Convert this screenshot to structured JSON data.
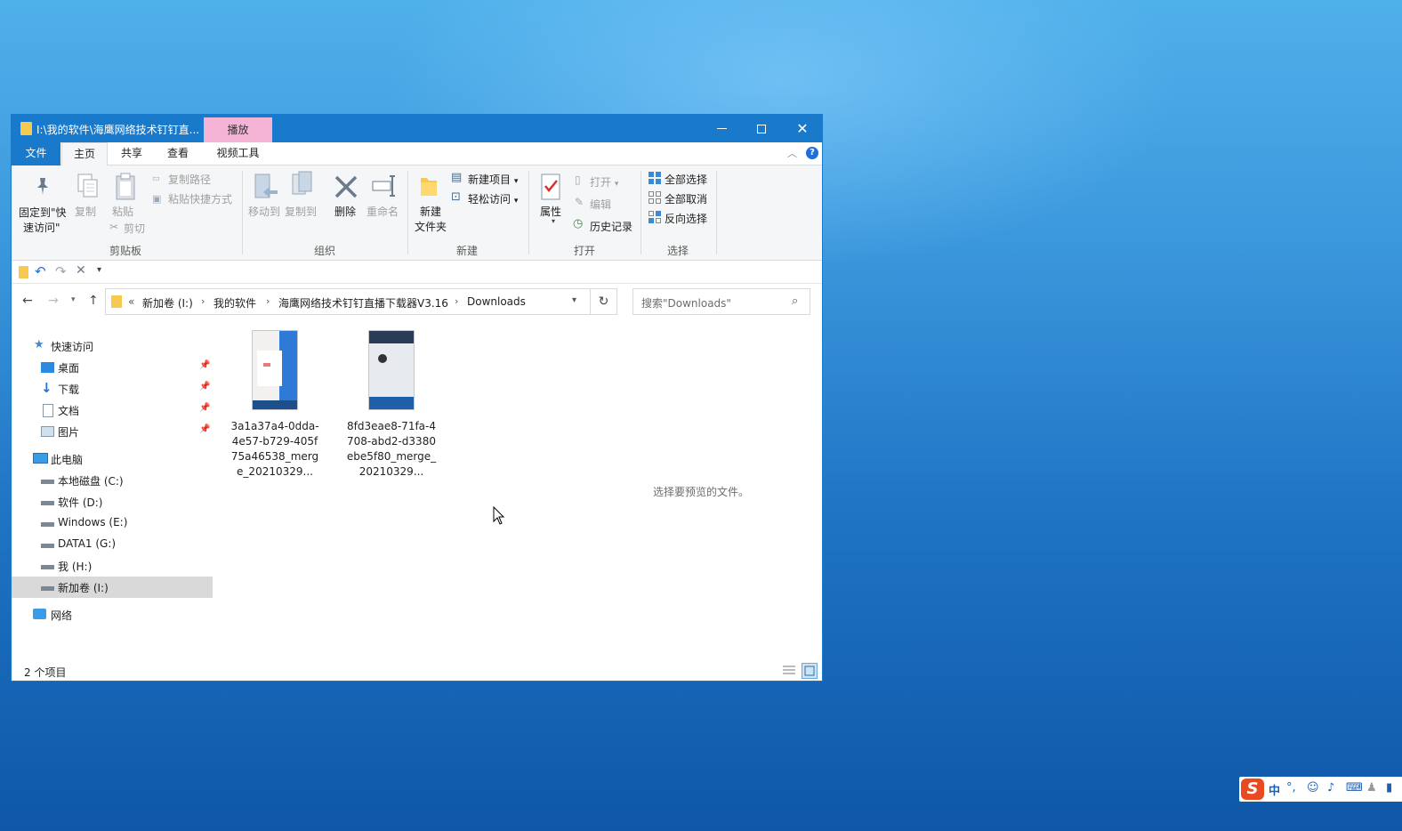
{
  "window": {
    "title": "I:\\我的软件\\海鹰网络技术钉钉直...",
    "context_tab": "播放",
    "controls": {
      "minimize": "minimize-icon",
      "maximize": "maximize-icon",
      "close": "close-icon"
    }
  },
  "tabs": {
    "file": "文件",
    "home": "主页",
    "share": "共享",
    "view": "查看",
    "video_tools": "视频工具"
  },
  "ribbon": {
    "clipboard": {
      "pin_line1": "固定到\"快",
      "pin_line2": "速访问\"",
      "copy": "复制",
      "paste": "粘贴",
      "copy_path": "复制路径",
      "paste_shortcut": "粘贴快捷方式",
      "cut": "剪切",
      "label": "剪贴板"
    },
    "organize": {
      "move_to": "移动到",
      "copy_to": "复制到",
      "delete": "删除",
      "rename": "重命名",
      "label": "组织"
    },
    "new": {
      "new_folder_line1": "新建",
      "new_folder_line2": "文件夹",
      "new_item": "新建项目",
      "easy_access": "轻松访问",
      "label": "新建"
    },
    "open": {
      "properties": "属性",
      "open": "打开",
      "edit": "编辑",
      "history": "历史记录",
      "label": "打开"
    },
    "select": {
      "select_all": "全部选择",
      "select_none": "全部取消",
      "invert": "反向选择",
      "label": "选择"
    }
  },
  "address": {
    "overflow": "«",
    "crumbs": [
      "新加卷 (I:)",
      "我的软件",
      "海鹰网络技术钉钉直播下载器V3.16",
      "Downloads"
    ],
    "search_placeholder": "搜索\"Downloads\""
  },
  "nav_pane": {
    "quick_access": "快速访问",
    "desktop": "桌面",
    "downloads": "下载",
    "documents": "文档",
    "pictures": "图片",
    "this_pc": "此电脑",
    "drive_c": "本地磁盘 (C:)",
    "drive_d": "软件 (D:)",
    "drive_e": "Windows (E:)",
    "drive_g": "DATA1 (G:)",
    "drive_h": "我 (H:)",
    "drive_i": "新加卷 (I:)",
    "network": "网络",
    "selected": "drive_i"
  },
  "files": [
    {
      "name": "3a1a37a4-0dda-4e57-b729-405f75a46538_merge_20210329..."
    },
    {
      "name": "8fd3eae8-71fa-4708-abd2-d3380ebe5f80_merge_20210329..."
    }
  ],
  "preview_message": "选择要预览的文件。",
  "status": {
    "item_count": "2 个项目"
  },
  "ime": {
    "logo": "S",
    "mode": "中",
    "punct": "°,"
  },
  "colors": {
    "accent": "#1979ca",
    "context_tab": "#f5b4d6",
    "ribbon_bg": "#f5f6f7",
    "selected_nav": "#d9d9d9"
  }
}
